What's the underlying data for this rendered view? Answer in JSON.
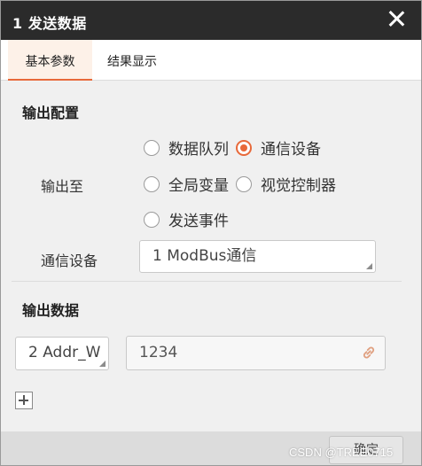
{
  "window": {
    "title": "1 发送数据"
  },
  "tabs": [
    {
      "label": "基本参数",
      "active": true
    },
    {
      "label": "结果显示",
      "active": false
    }
  ],
  "output_config": {
    "section_title": "输出配置",
    "output_to_label": "输出至",
    "options": [
      {
        "label": "数据队列",
        "checked": false
      },
      {
        "label": "通信设备",
        "checked": true
      },
      {
        "label": "全局变量",
        "checked": false
      },
      {
        "label": "视觉控制器",
        "checked": false
      },
      {
        "label": "发送事件",
        "checked": false
      }
    ],
    "device_label": "通信设备",
    "device_value": "1 ModBus通信"
  },
  "output_data": {
    "section_title": "输出数据",
    "address_value": "2 Addr_W",
    "data_value": "1234"
  },
  "footer": {
    "ok_label": "确定"
  },
  "watermark": "CSDN @TREE0715",
  "colors": {
    "accent": "#e8693a",
    "titlebar": "#2b2b2b"
  }
}
